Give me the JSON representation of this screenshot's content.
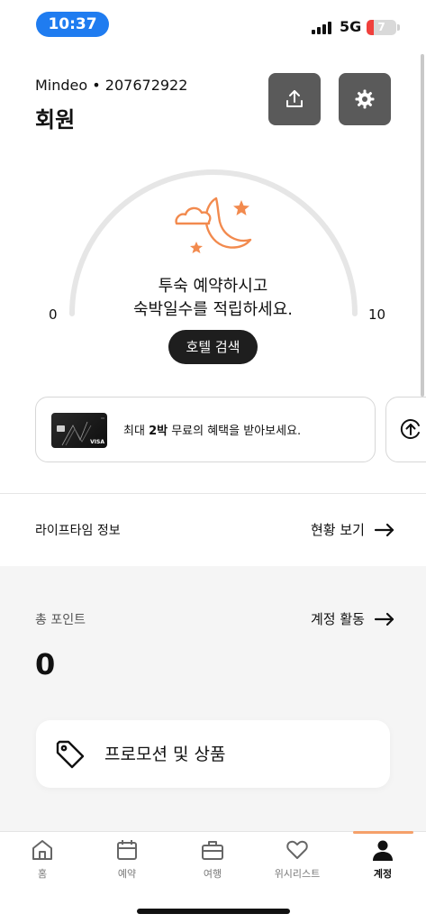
{
  "status_bar": {
    "time": "10:37",
    "network": "5G",
    "battery_level": "7"
  },
  "header": {
    "member_info": "Mindeo • 207672922",
    "title": "회원"
  },
  "gauge": {
    "min_label": "0",
    "max_label": "10",
    "message_line1": "투숙 예약하시고",
    "message_line2": "숙박일수를 적립하세요.",
    "search_button": "호텔 검색"
  },
  "promo_banner": {
    "text_before": "최대 ",
    "text_bold": "2박",
    "text_after": " 무료의 혜택을 받아보세요.",
    "card_visa": "VISA"
  },
  "lifetime": {
    "label": "라이프타임 정보",
    "link": "현황 보기"
  },
  "points": {
    "label": "총 포인트",
    "link": "계정 활동",
    "value": "0"
  },
  "promotions": {
    "label": "프로모션 및 상품"
  },
  "tabs": [
    {
      "label": "홈"
    },
    {
      "label": "예약"
    },
    {
      "label": "여행"
    },
    {
      "label": "위시리스트"
    },
    {
      "label": "계정"
    }
  ],
  "colors": {
    "accent": "#f5a06a",
    "time_pill": "#1f7cf0",
    "button_dark": "#1e1e1e",
    "icon_button": "#5a5a5a"
  }
}
